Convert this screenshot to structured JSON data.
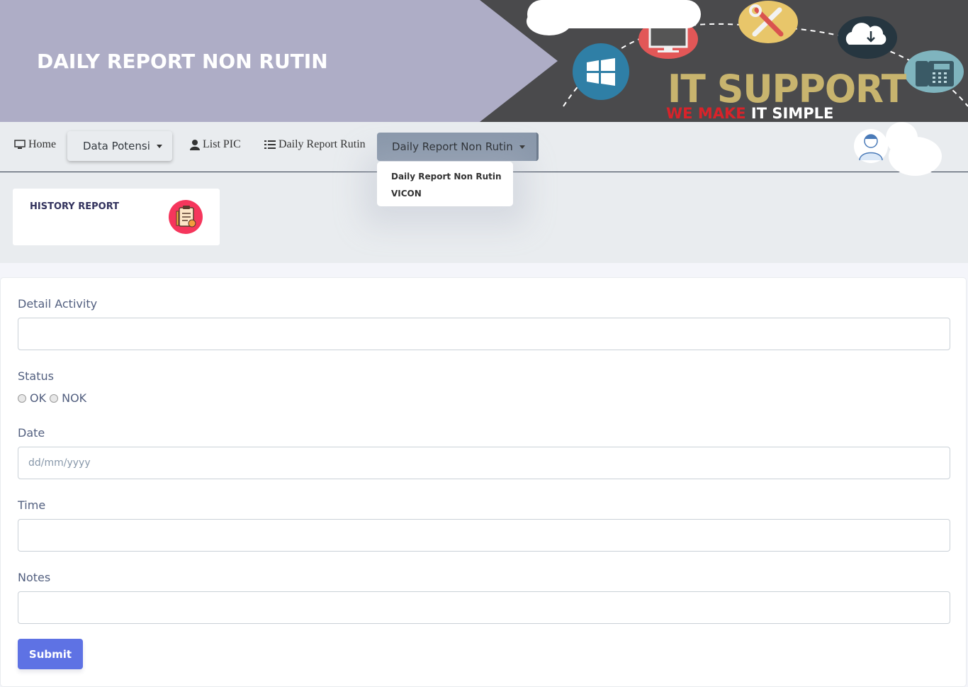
{
  "banner": {
    "title": "DAILY REPORT NON RUTIN",
    "logo_main": "IT SUPPORT",
    "logo_tag_red": "WE MAKE",
    "logo_tag_white": "IT SIMPLE"
  },
  "nav": {
    "home": "Home",
    "data_potensi": "Data Potensi",
    "list_pic": "List PIC",
    "daily_report_rutin": "Daily Report Rutin",
    "daily_report_non_rutin": "Daily Report Non Rutin"
  },
  "dropdown": {
    "items": [
      "Daily Report Non Rutin",
      "VICON"
    ]
  },
  "card": {
    "title": "HISTORY REPORT"
  },
  "form": {
    "detail_activity_label": "Detail Activity",
    "detail_activity_value": "",
    "status_label": "Status",
    "status_options": [
      "OK",
      "NOK"
    ],
    "date_label": "Date",
    "date_placeholder": "dd/mm/yyyy",
    "time_label": "Time",
    "time_value": "",
    "notes_label": "Notes",
    "notes_value": "",
    "submit_label": "Submit"
  },
  "colors": {
    "banner_left": "#aeadc6",
    "banner_right": "#4a4a4c",
    "primary": "#5e72e4",
    "card_icon": "#f5365c",
    "active_nav": "#8a98ab"
  }
}
